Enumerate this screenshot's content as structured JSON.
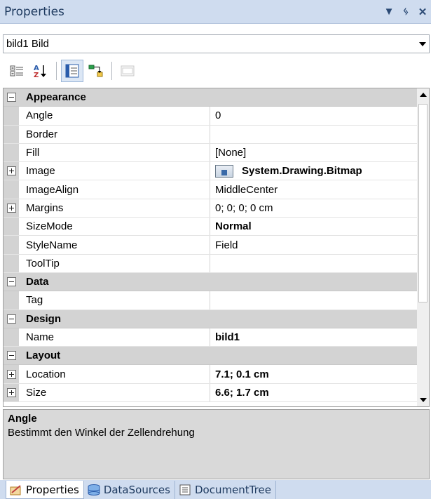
{
  "window": {
    "title": "Properties",
    "controls": {
      "dropdown": "▼",
      "pin": "ᛃ",
      "close": "✕"
    }
  },
  "object_selector": {
    "value": "bild1 Bild"
  },
  "toolbar": {
    "items": [
      "categorized-icon",
      "alphabetical-icon",
      "properties-icon",
      "events-icon",
      "property-pages-icon"
    ],
    "alpha_glyph": "A↓"
  },
  "grid": {
    "categories": {
      "appearance": "Appearance",
      "data": "Data",
      "design": "Design",
      "layout": "Layout"
    },
    "rows": {
      "angle": {
        "name": "Angle",
        "value": "0"
      },
      "border": {
        "name": "Border",
        "value": ""
      },
      "fill": {
        "name": "Fill",
        "value": "[None]"
      },
      "image": {
        "name": "Image",
        "value": "System.Drawing.Bitmap"
      },
      "imagealign": {
        "name": "ImageAlign",
        "value": "MiddleCenter"
      },
      "margins": {
        "name": "Margins",
        "value": "0; 0; 0; 0 cm"
      },
      "sizemode": {
        "name": "SizeMode",
        "value": "Normal"
      },
      "stylename": {
        "name": "StyleName",
        "value": "Field"
      },
      "tooltip": {
        "name": "ToolTip",
        "value": ""
      },
      "tag": {
        "name": "Tag",
        "value": ""
      },
      "name": {
        "name": "Name",
        "value": "bild1"
      },
      "location": {
        "name": "Location",
        "value": "7.1; 0.1 cm"
      },
      "size": {
        "name": "Size",
        "value": "6.6; 1.7 cm"
      }
    }
  },
  "description": {
    "title": "Angle",
    "text": "Bestimmt den Winkel der Zellendrehung"
  },
  "tabs": [
    {
      "label": "Properties",
      "icon": "properties-tab-icon",
      "active": true
    },
    {
      "label": "DataSources",
      "icon": "datasources-tab-icon",
      "active": false
    },
    {
      "label": "DocumentTree",
      "icon": "documenttree-tab-icon",
      "active": false
    }
  ]
}
